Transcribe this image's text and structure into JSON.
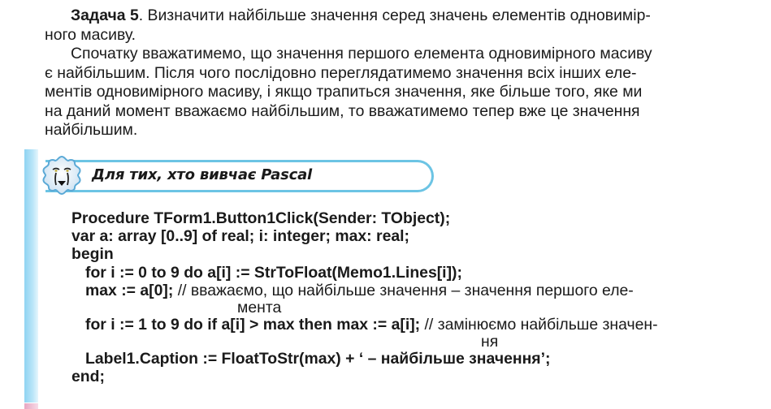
{
  "task": {
    "label": "Задача 5",
    "line1_rest": ". Визначити найбільше значення серед значень елементів одновимір-",
    "line2": "ного масиву."
  },
  "explanation": {
    "lines": [
      "Спочатку вважатимемо, що значення першого елемента одновимірного масиву",
      "є найбільшим. Після чого послідовно переглядатимемо значення всіх інших еле-",
      "ментів одновимірного масиву, і якщо трапиться значення, яке більше того, яке ми",
      "на даний момент вважаємо найбільшим, то вважатимемо тепер вже це значення",
      "найбільшим."
    ]
  },
  "banner": {
    "icon": "lion-head-icon",
    "title": "Для тих, хто вивчає Pascal",
    "accent_color": "#6cc4e4"
  },
  "code": {
    "line1": "Procedure TForm1.Button1Click(Sender: TObject);",
    "line2": "var a: array [0..9] of real; i: integer; max: real;",
    "line3": "begin",
    "line4": "for i := 0 to 9 do a[i] := StrToFloat(Memo1.Lines[i]);",
    "line5_code": "max := a[0];",
    "line5_comment": " // вважаємо, що найбільше значення – значення першого еле-",
    "line5_cont": "мента",
    "line6_code": "for i := 1 to 9 do if a[i] > max then max := a[i];",
    "line6_comment": " // замінюємо найбільше значен-",
    "line6_cont": "ня",
    "line7": "Label1.Caption := FloatToStr(max) + ‘  – найбільше значення’;",
    "line8": "end;"
  }
}
